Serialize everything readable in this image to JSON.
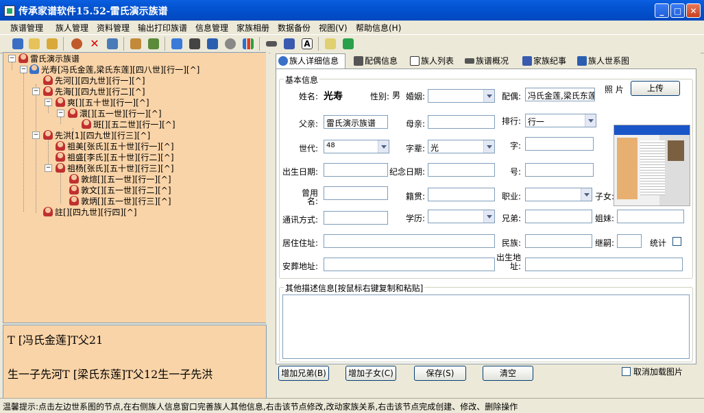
{
  "window": {
    "title": "传承家谱软件15.52-雷氏演示族谱"
  },
  "menu": [
    "族谱管理",
    "族人管理",
    "资料管理",
    "输出打印族谱",
    "信息管理",
    "家族相册",
    "数据备份",
    "视图(V)",
    "帮助信息(H)"
  ],
  "toolbar_icons": [
    "bookmark-icon",
    "book-icon",
    "folder-icon",
    "user-icon",
    "delete-icon",
    "id-card-icon",
    "family-icon",
    "group-icon",
    "copy-icon",
    "binoculars-icon",
    "network-icon",
    "gear-icon",
    "bar-chart-icon",
    "glasses-icon",
    "book-open-icon",
    "text-a-icon",
    "chat-icon",
    "exit-icon"
  ],
  "tree": [
    {
      "label": "雷氏演示族谱",
      "level": 0
    },
    {
      "label": "光寿[冯氏金莲,梁氏东莲][四八世][行一][^]",
      "level": 1
    },
    {
      "label": "先河[][四九世][行一][^]",
      "level": 2
    },
    {
      "label": "先海[][四九世][行二][^]",
      "level": 2
    },
    {
      "label": "爽[][五十世][行一][^]",
      "level": 3
    },
    {
      "label": "澴[][五一世][行一][^]",
      "level": 4
    },
    {
      "label": "斑[][五二世][行一][^]",
      "level": 5
    },
    {
      "label": "先洪[1][四九世][行三][^]",
      "level": 2
    },
    {
      "label": "祖美[张氏][五十世][行一][^]",
      "level": 3
    },
    {
      "label": "祖盛[李氏][五十世][行二][^]",
      "level": 3
    },
    {
      "label": "祖杨[张氏][五十世][行三][^]",
      "level": 3
    },
    {
      "label": "敦煊[][五一世][行一][^]",
      "level": 4
    },
    {
      "label": "敦文[][五一世][行二][^]",
      "level": 4
    },
    {
      "label": "敦炳[][五一世][行三][^]",
      "level": 4
    },
    {
      "label": "註[][四九世][行四][^]",
      "level": 2
    }
  ],
  "memo": {
    "line1": "T [冯氏金莲]T父21",
    "line2": "生一子先河T  [梁氏东莲]T父12生一子先洪"
  },
  "tabs": [
    "族人详细信息",
    "配偶信息",
    "族人列表",
    "族谱概况",
    "家族纪事",
    "族人世系图"
  ],
  "basic": {
    "group_title": "基本信息",
    "name_label": "姓名:",
    "name_value": "光寿",
    "gender_label": "性别:",
    "gender_value": "男",
    "marriage_label": "婚姻:",
    "marriage_value": "",
    "spouse_label": "配偶:",
    "spouse_value": "冯氏金莲,梁氏东莲",
    "photo_label": "照 片",
    "upload_label": "上传",
    "father_label": "父亲:",
    "father_value": "雷氏演示族谱",
    "mother_label": "母亲:",
    "mother_value": "",
    "rank_label": "排行:",
    "rank_value": "行一",
    "generation_label": "世代:",
    "generation_value": "48",
    "zibei_label": "字辈:",
    "zibei_value": "光",
    "zi_label": "字:",
    "zi_value": "",
    "birth_label": "出生日期:",
    "birth_value": "",
    "memorial_label": "纪念日期:",
    "memorial_value": "",
    "hao_label": "号:",
    "hao_value": "",
    "former_name_label": "曾用名:",
    "former_name_value": "",
    "native_label": "籍贯:",
    "native_value": "",
    "job_label": "职业:",
    "job_value": "",
    "children_label": "子女:",
    "children_value": "",
    "contact_label": "通讯方式:",
    "contact_value": "",
    "edu_label": "学历:",
    "edu_value": "",
    "brothers_label": "兄弟:",
    "brothers_value": "",
    "sisters_label": "姐妹:",
    "sisters_value": "",
    "address_label": "居住住址:",
    "address_value": "",
    "ethnic_label": "民族:",
    "ethnic_value": "",
    "heir_label": "继嗣:",
    "heir_value": "",
    "stat_label": "统计",
    "burial_label": "安葬地址:",
    "burial_value": "",
    "birthplace_label": "出生地址:",
    "birthplace_value": ""
  },
  "other": {
    "group_title": "其他描述信息[按鼠标右键复制和粘贴]",
    "content": ""
  },
  "buttons": {
    "add_sibling": "增加兄弟(B)",
    "add_child": "增加子女(C)",
    "save": "保存(S)",
    "clear": "清空",
    "cancel_photo": "取消加载图片"
  },
  "status": "温馨提示:点击左边世系图的节点,在右侧族人信息窗口完善族人其他信息,右击该节点修改,改动家族关系,右击该节点完成创建、修改、删除操作"
}
